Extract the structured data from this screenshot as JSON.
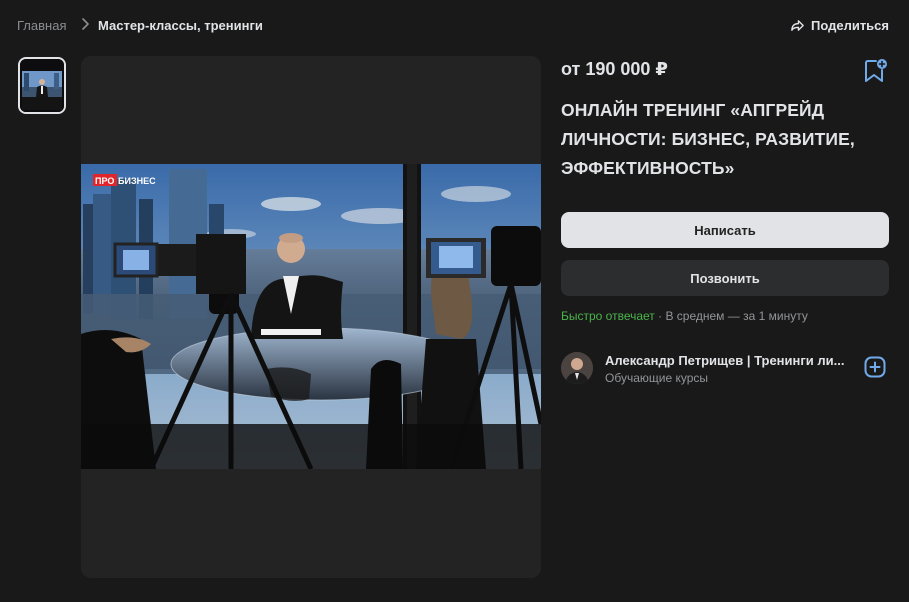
{
  "breadcrumb": {
    "home": "Главная",
    "current": "Мастер-классы, тренинги"
  },
  "share_label": "Поделиться",
  "product": {
    "price": "от 190 000 ₽",
    "title": "ОНЛАЙН ТРЕНИНГ «АПГРЕЙД ЛИЧНОСТИ: БИЗНЕС, РАЗВИТИЕ, ЭФФЕКТИВНОСТЬ»",
    "photo_logo_pro": "ПРО",
    "photo_logo_biz": "БИЗНЕС"
  },
  "actions": {
    "write_label": "Написать",
    "call_label": "Позвонить"
  },
  "response": {
    "fast": "Быстро отвечает",
    "rest": " · В среднем — за 1 минуту"
  },
  "seller": {
    "name": "Александр Петрищев | Тренинги ли...",
    "category": "Обучающие курсы"
  },
  "colors": {
    "background": "#191919",
    "accent": "#71aaeb",
    "fast_reply": "#4bb34b",
    "primary_button": "#e1e3e6"
  },
  "icons": {
    "share": "share-arrow-icon",
    "bookmark": "bookmark-add-icon",
    "add": "add-square-icon",
    "separator": "chevron-right-icon"
  }
}
